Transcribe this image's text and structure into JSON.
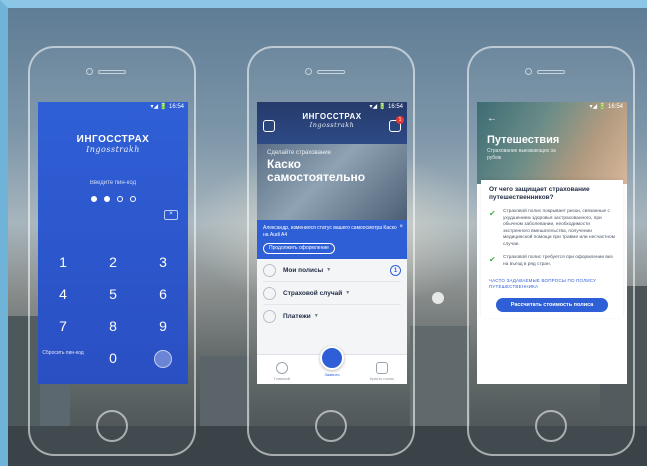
{
  "phone1": {
    "status": "▾◢ 🔋 16:54",
    "logo_main": "ИНГОССТРАХ",
    "logo_script": "Ingosstrakh",
    "pin_label": "Введите пин-код",
    "keys": [
      "1",
      "2",
      "3",
      "4",
      "5",
      "6",
      "7",
      "8",
      "9"
    ],
    "reset_label": "Сбросить пин-код",
    "zero": "0"
  },
  "phone2": {
    "status": "▾◢ 🔋 16:54",
    "logo_main": "ИНГОССТРАХ",
    "logo_script": "Ingosstrakh",
    "badge": "1",
    "banner_sub": "Сделайте страхование",
    "banner_title": "Каско самостоятельно",
    "notice_text": "Александр, изменился статус вашего самоосмотра Каско на Audi A4",
    "notice_button": "Продолжить оформление",
    "menu": [
      {
        "label": "Мои полисы",
        "count": "1"
      },
      {
        "label": "Страховой случай",
        "count": ""
      },
      {
        "label": "Платежи",
        "count": ""
      }
    ],
    "tabs": [
      "Главный",
      "Заявить",
      "Купить полис"
    ]
  },
  "phone3": {
    "status": "▾◢ 🔋 16:54",
    "back": "←",
    "title": "Путешествия",
    "subtitle": "Страхование выезжающих за рубеж",
    "question": "От чего защищает страхование путешественников?",
    "items": [
      "Страховой полис покрывает риски, связанные с ухудшением здоровья застрахованного, при обычном заболевании, необходимости экстренного вмешательства, получении медицинской помощи при травме или несчастном случае.",
      "Страховой полис требуется при оформлении виз на въезд в ряд стран."
    ],
    "faq": "ЧАСТО ЗАДАВАЕМЫЕ ВОПРОСЫ ПО ПОЛИСУ ПУТЕШЕСТВЕННИКА",
    "cta": "Рассчитать стоимость полиса"
  }
}
